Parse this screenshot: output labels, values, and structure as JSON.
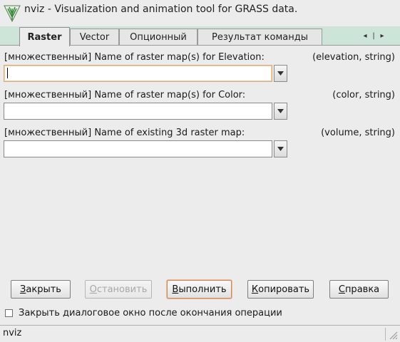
{
  "window": {
    "title": "nviz - Visualization and animation tool for GRASS data."
  },
  "tabs": [
    {
      "label": "Raster",
      "active": true
    },
    {
      "label": "Vector",
      "active": false
    },
    {
      "label": "Опционный",
      "active": false
    },
    {
      "label": "Результат команды",
      "active": false
    }
  ],
  "tab_nav": {
    "first": "◂",
    "prev": "|",
    "next": "▸"
  },
  "fields": [
    {
      "label": "[множественный] Name of raster map(s) for Elevation:",
      "type": "(elevation, string)",
      "value": ""
    },
    {
      "label": "[множественный] Name of raster map(s) for Color:",
      "type": "(color, string)",
      "value": ""
    },
    {
      "label": "[множественный] Name of existing 3d raster map:",
      "type": "(volume, string)",
      "value": ""
    }
  ],
  "buttons": {
    "close": {
      "pre": "",
      "mnemonic": "З",
      "post": "акрыть"
    },
    "stop": {
      "pre": "",
      "mnemonic": "О",
      "post": "становить"
    },
    "run": {
      "pre": "",
      "mnemonic": "В",
      "post": "ыполнить"
    },
    "copy": {
      "pre": "",
      "mnemonic": "К",
      "post": "опировать"
    },
    "help": {
      "pre": "",
      "mnemonic": "С",
      "post": "правка"
    }
  },
  "close_on_finish": {
    "label": "Закрыть диалоговое окно после окончания операции",
    "checked": false
  },
  "status": {
    "text": "nviz"
  }
}
